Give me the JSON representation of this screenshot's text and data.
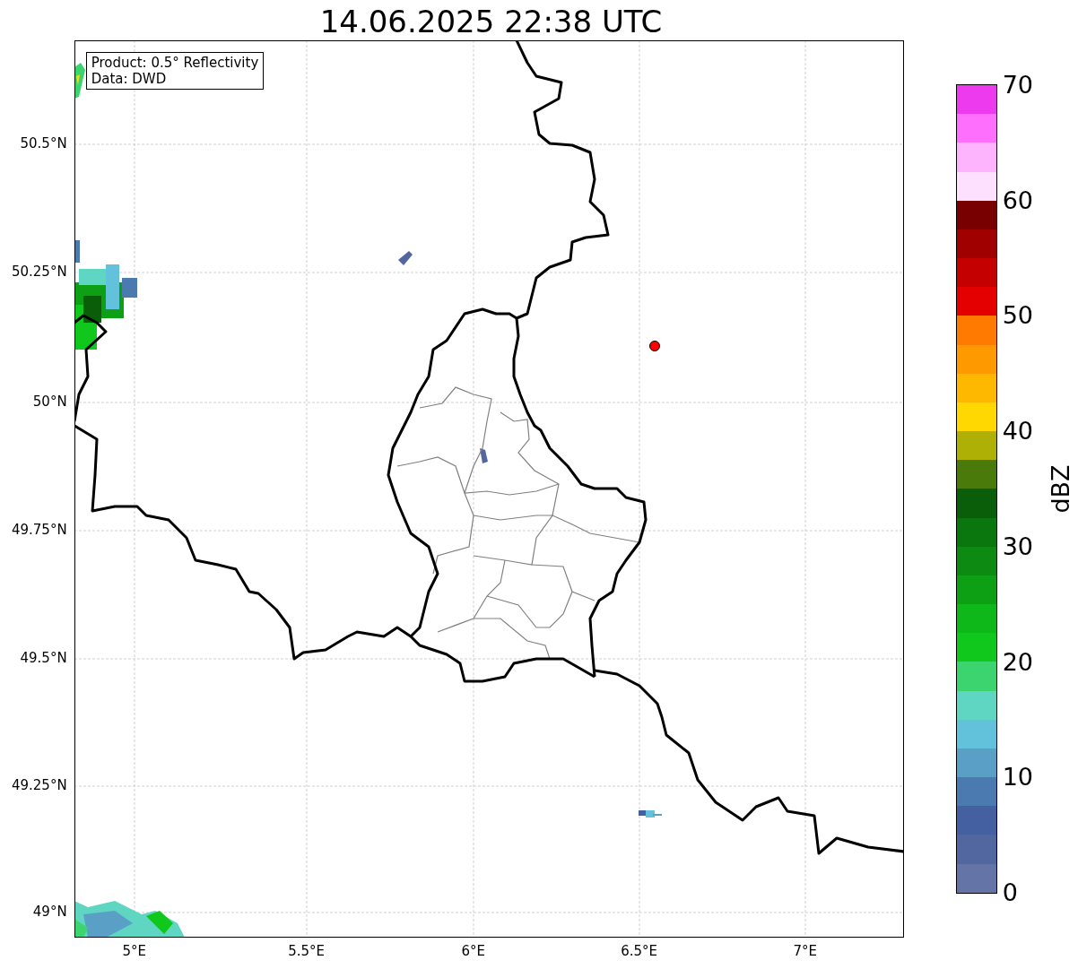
{
  "title": "14.06.2025 22:38 UTC",
  "info_box": [
    "Product: 0.5° Reflectivity",
    "Data: DWD"
  ],
  "x_ticks": [
    "5°E",
    "5.5°E",
    "6°E",
    "6.5°E",
    "7°E"
  ],
  "y_ticks": [
    "50.5°N",
    "50.25°N",
    "50°N",
    "49.75°N",
    "49.5°N",
    "49.25°N",
    "49°N"
  ],
  "colorbar": {
    "label": "dBZ",
    "ticks": [
      "70",
      "60",
      "50",
      "40",
      "30",
      "20",
      "10",
      "0"
    ],
    "segments": [
      {
        "color": "#6474a6"
      },
      {
        "color": "#5266a0"
      },
      {
        "color": "#4460a0"
      },
      {
        "color": "#4a7ab0"
      },
      {
        "color": "#5aa0c6"
      },
      {
        "color": "#62c2dc"
      },
      {
        "color": "#5ed6c2"
      },
      {
        "color": "#3cd46e"
      },
      {
        "color": "#10c81c"
      },
      {
        "color": "#0eb818"
      },
      {
        "color": "#0ea014"
      },
      {
        "color": "#0c8a12"
      },
      {
        "color": "#0a760e"
      },
      {
        "color": "#0a5e0a"
      },
      {
        "color": "#4a7a0a"
      },
      {
        "color": "#afb005"
      },
      {
        "color": "#fed800"
      },
      {
        "color": "#feb800"
      },
      {
        "color": "#fe9a00"
      },
      {
        "color": "#fe7a00"
      },
      {
        "color": "#e40000"
      },
      {
        "color": "#c40000"
      },
      {
        "color": "#a00000"
      },
      {
        "color": "#780000"
      },
      {
        "color": "#fde0fd"
      },
      {
        "color": "#fdb4fd"
      },
      {
        "color": "#fe6ffe"
      },
      {
        "color": "#ee3aee"
      }
    ]
  }
}
